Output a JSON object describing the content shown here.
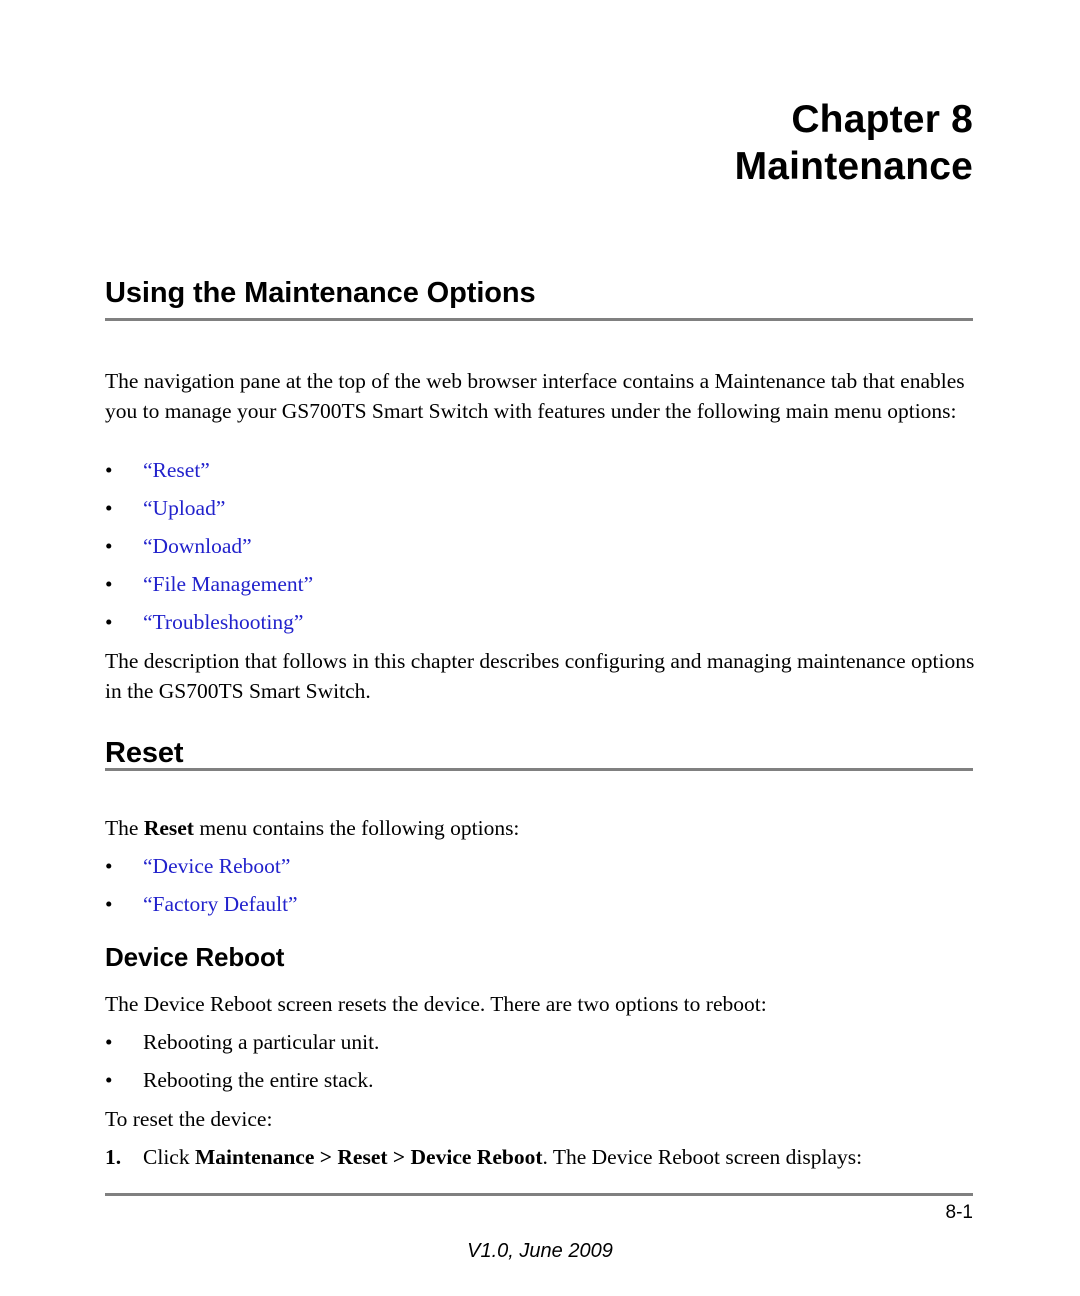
{
  "chapter": {
    "number_line": "Chapter 8",
    "title_line": "Maintenance"
  },
  "sections": {
    "using_options": {
      "heading": "Using the Maintenance Options",
      "intro_paragraph": "The navigation pane at the top of the web browser interface contains a Maintenance tab that enables you to manage your GS700TS Smart Switch with features under the following main menu options:",
      "xref_bullets": [
        "“Reset”",
        "“Upload”",
        "“Download”",
        "“File Management”",
        "“Troubleshooting”"
      ],
      "closing_paragraph": "The description that follows in this chapter describes configuring and managing maintenance options in the GS700TS Smart Switch."
    },
    "reset": {
      "heading": "Reset",
      "intro_prefix": "The ",
      "intro_bold": "Reset",
      "intro_suffix": " menu contains the following options:",
      "xref_bullets": [
        "“Device Reboot”",
        "“Factory Default”"
      ]
    },
    "device_reboot": {
      "heading": "Device Reboot",
      "intro_paragraph": "The Device Reboot screen resets the device.  There are two options to reboot:",
      "bullets": [
        "Rebooting a particular unit.",
        "Rebooting the entire stack."
      ],
      "lead_in": "To reset the device:",
      "step": {
        "number": "1.",
        "text_prefix": "Click ",
        "text_bold": "Maintenance > Reset > Device Reboot",
        "text_suffix": ". The Device Reboot screen displays:"
      }
    }
  },
  "footer": {
    "page_number": "8-1",
    "version": "V1.0, June 2009"
  },
  "bullet_glyph": "•",
  "colors": {
    "xref_blue": "#2222cc",
    "rule_gray": "#808080",
    "text_black": "#000000"
  }
}
